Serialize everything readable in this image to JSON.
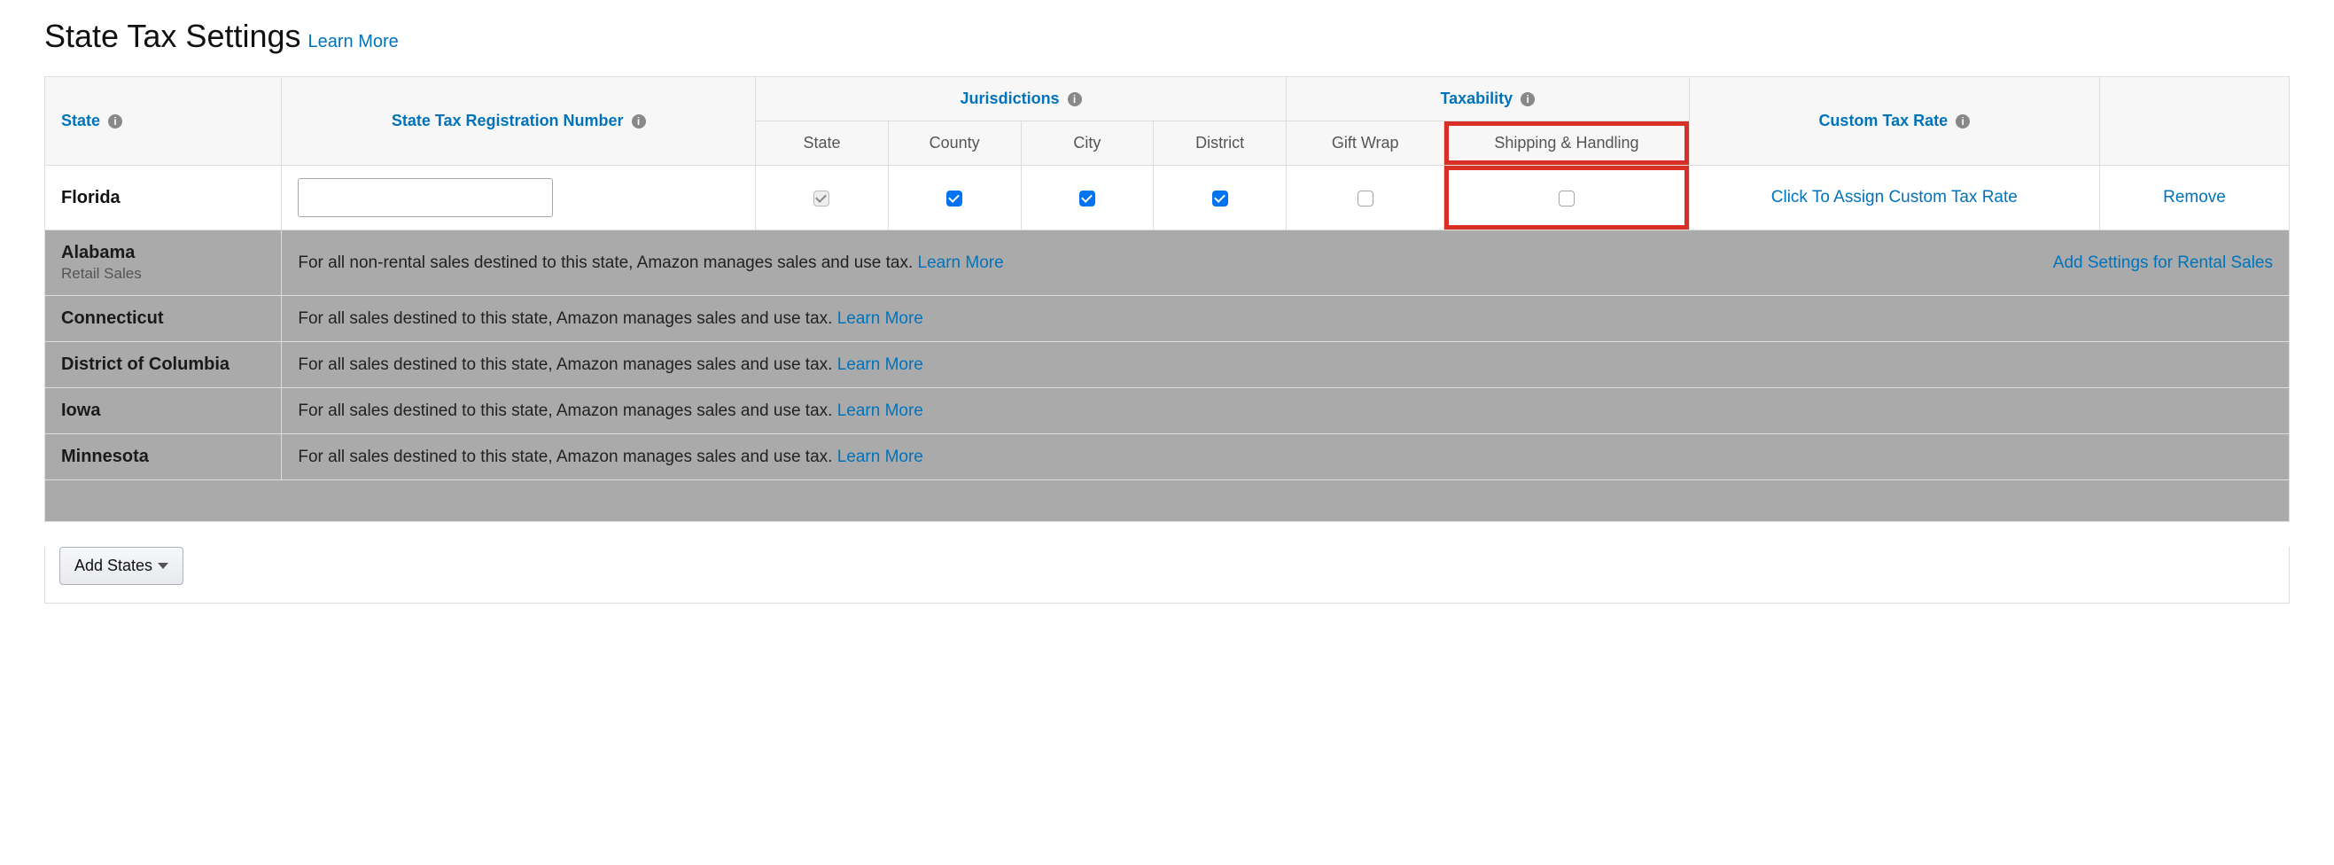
{
  "title": "State Tax Settings",
  "learn_more": "Learn More",
  "headers": {
    "state": "State",
    "registration": "State Tax Registration Number",
    "jurisdictions": "Jurisdictions",
    "taxability": "Taxability",
    "custom_rate": "Custom Tax Rate",
    "remove": "",
    "sub_state": "State",
    "sub_county": "County",
    "sub_city": "City",
    "sub_district": "District",
    "sub_gift_wrap": "Gift Wrap",
    "sub_shipping": "Shipping & Handling"
  },
  "florida": {
    "name": "Florida",
    "registration_value": "",
    "state_checked": true,
    "state_disabled": true,
    "county_checked": true,
    "city_checked": true,
    "district_checked": true,
    "gift_wrap_checked": false,
    "shipping_checked": false,
    "custom_rate_label": "Click To Assign Custom Tax Rate",
    "remove_label": "Remove"
  },
  "managed": [
    {
      "name": "Alabama",
      "subtext": "Retail Sales",
      "desc_prefix": "For all non-rental sales destined to this state, Amazon manages sales and use tax. ",
      "learn": "Learn More",
      "trail": "Add Settings for Rental Sales"
    },
    {
      "name": "Connecticut",
      "subtext": "",
      "desc_prefix": "For all sales destined to this state, Amazon manages sales and use tax. ",
      "learn": "Learn More",
      "trail": ""
    },
    {
      "name": "District of Columbia",
      "subtext": "",
      "desc_prefix": "For all sales destined to this state, Amazon manages sales and use tax. ",
      "learn": "Learn More",
      "trail": ""
    },
    {
      "name": "Iowa",
      "subtext": "",
      "desc_prefix": "For all sales destined to this state, Amazon manages sales and use tax. ",
      "learn": "Learn More",
      "trail": ""
    },
    {
      "name": "Minnesota",
      "subtext": "",
      "desc_prefix": "For all sales destined to this state, Amazon manages sales and use tax. ",
      "learn": "Learn More",
      "trail": ""
    }
  ],
  "add_states_label": "Add States"
}
